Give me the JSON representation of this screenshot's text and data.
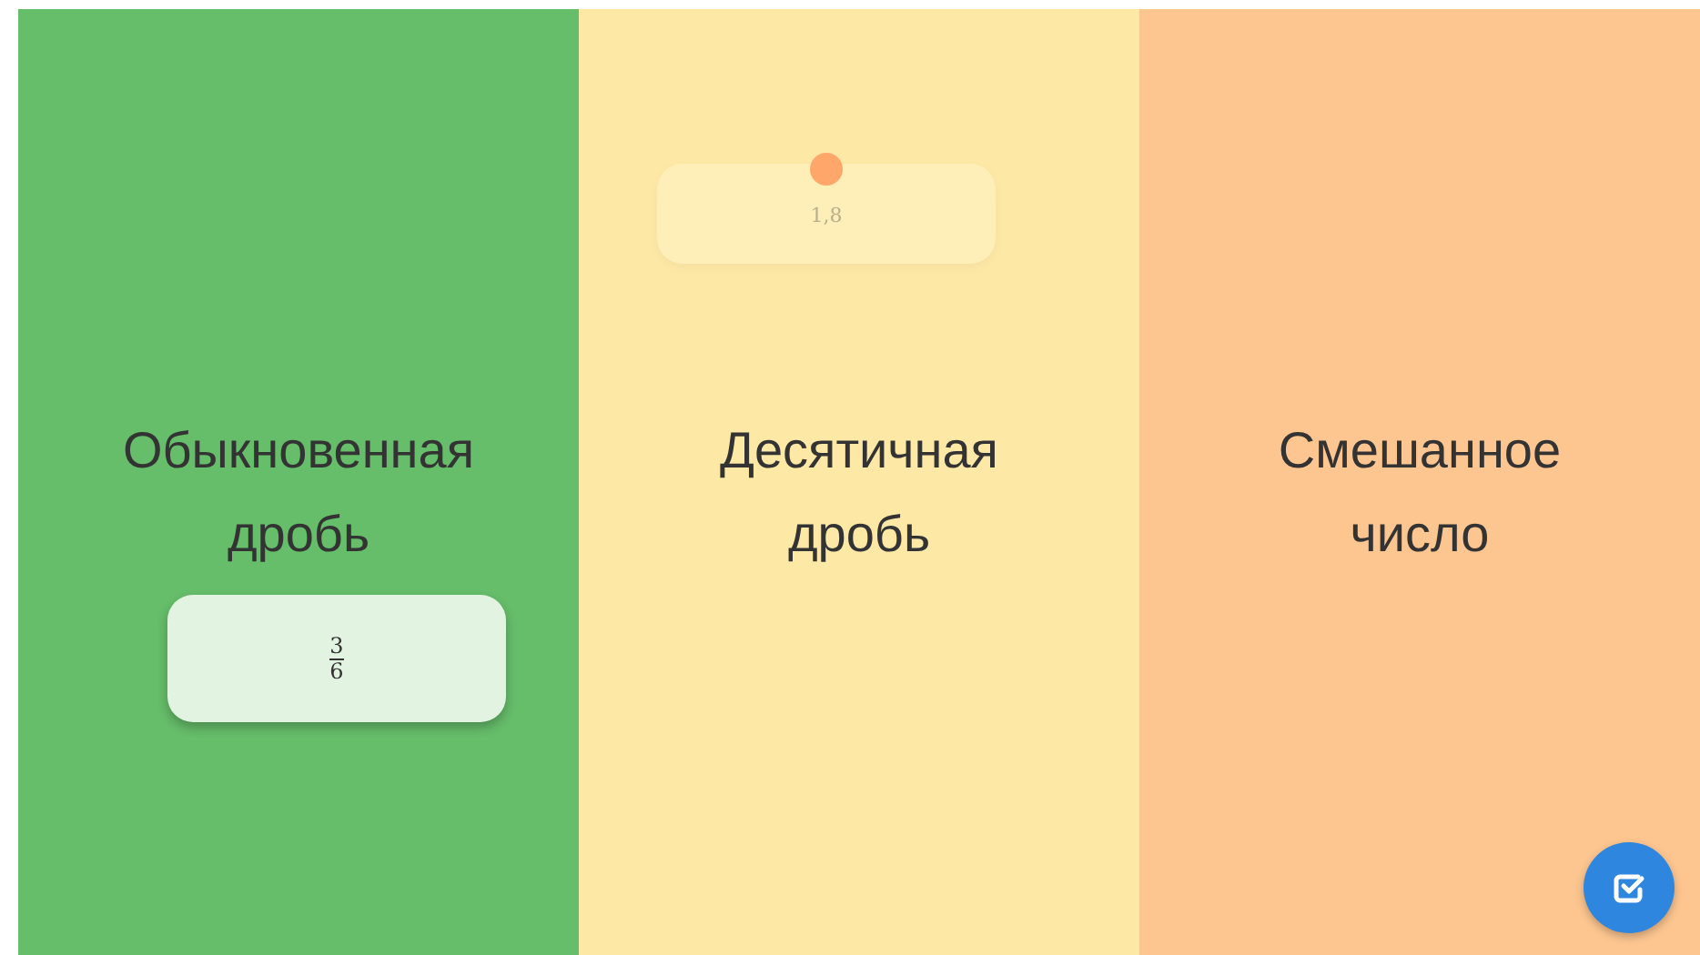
{
  "columns": [
    {
      "title": "Обыкновенная дробь",
      "color": "#66bd6a",
      "cards": [
        {
          "kind": "fraction",
          "numerator": "3",
          "denominator": "6",
          "dimmed": false
        }
      ]
    },
    {
      "title": "Десятичная дробь",
      "color": "#fde8a6",
      "cards": [
        {
          "kind": "decimal",
          "value": "1,8",
          "dimmed": true
        }
      ]
    },
    {
      "title": "Смешанное число",
      "color": "#fdc690"
    }
  ]
}
